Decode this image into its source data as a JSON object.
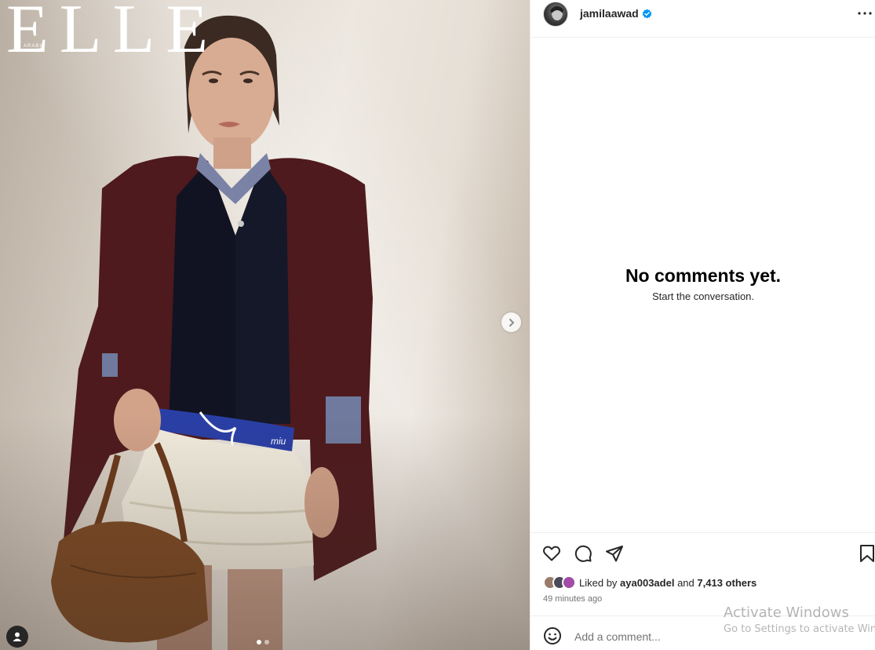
{
  "post": {
    "magazine": "ELLE",
    "magazine_sub": "ARABIA",
    "carousel_count": 2,
    "carousel_active": 0
  },
  "header": {
    "username": "jamilaawad",
    "verified": true
  },
  "comments": {
    "empty_title": "No comments yet.",
    "empty_subtitle": "Start the conversation."
  },
  "actions": {
    "icons": [
      "heart-icon",
      "comment-icon",
      "share-icon",
      "bookmark-icon"
    ]
  },
  "likes": {
    "prefix": "Liked by",
    "first_liker": "aya003adel",
    "conjunction": "and",
    "others": "7,413 others"
  },
  "timestamp": "49 minutes ago",
  "comment_box": {
    "placeholder": "Add a comment..."
  },
  "os_watermark": {
    "line1": "Activate Windows",
    "line2": "Go to Settings to activate Windows."
  },
  "colors": {
    "verified_blue": "#0095f6",
    "text_primary": "#262626",
    "text_secondary": "#737373",
    "divider": "#efefef"
  }
}
